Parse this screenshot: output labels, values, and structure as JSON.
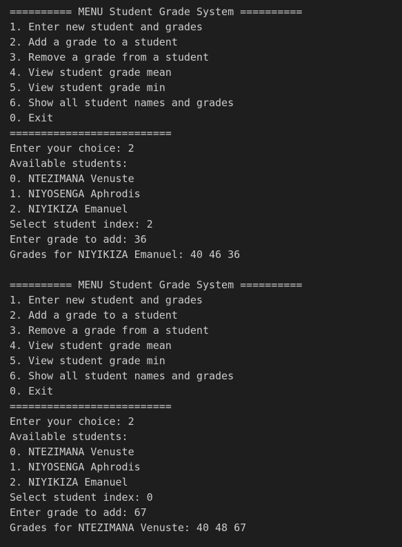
{
  "terminal": {
    "blocks": [
      {
        "menu": {
          "header": "========== MENU Student Grade System ==========",
          "items": [
            "1. Enter new student and grades",
            "2. Add a grade to a student",
            "3. Remove a grade from a student",
            "4. View student grade mean",
            "5. View student grade min",
            "6. Show all student names and grades",
            "0. Exit"
          ],
          "footer": "=========================="
        },
        "choice_prompt": "Enter your choice: 2",
        "students_header": "Available students:",
        "students": [
          "0. NTEZIMANA Venuste",
          "1. NIYOSENGA Aphrodis",
          "2. NIYIKIZA Emanuel"
        ],
        "index_prompt": "Select student index: 2",
        "grade_prompt": "Enter grade to add: 36",
        "result": "Grades for NIYIKIZA Emanuel: 40 46 36"
      },
      {
        "menu": {
          "header": "========== MENU Student Grade System ==========",
          "items": [
            "1. Enter new student and grades",
            "2. Add a grade to a student",
            "3. Remove a grade from a student",
            "4. View student grade mean",
            "5. View student grade min",
            "6. Show all student names and grades",
            "0. Exit"
          ],
          "footer": "=========================="
        },
        "choice_prompt": "Enter your choice: 2",
        "students_header": "Available students:",
        "students": [
          "0. NTEZIMANA Venuste",
          "1. NIYOSENGA Aphrodis",
          "2. NIYIKIZA Emanuel"
        ],
        "index_prompt": "Select student index: 0",
        "grade_prompt": "Enter grade to add: 67",
        "result": "Grades for NTEZIMANA Venuste: 40 48 67"
      }
    ]
  }
}
